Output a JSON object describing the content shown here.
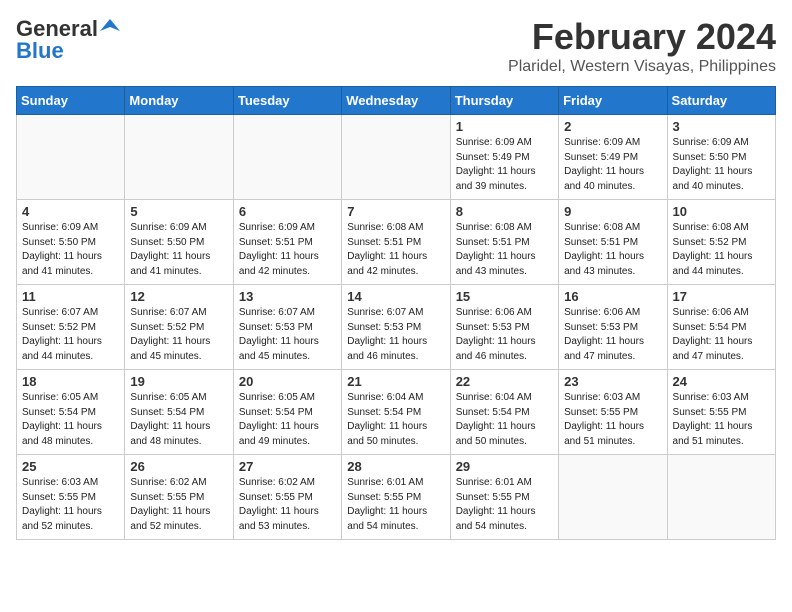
{
  "header": {
    "logo_general": "General",
    "logo_blue": "Blue",
    "month": "February 2024",
    "location": "Plaridel, Western Visayas, Philippines"
  },
  "days_of_week": [
    "Sunday",
    "Monday",
    "Tuesday",
    "Wednesday",
    "Thursday",
    "Friday",
    "Saturday"
  ],
  "weeks": [
    [
      {
        "day": "",
        "empty": true
      },
      {
        "day": "",
        "empty": true
      },
      {
        "day": "",
        "empty": true
      },
      {
        "day": "",
        "empty": true
      },
      {
        "day": "1",
        "sunrise": "6:09 AM",
        "sunset": "5:49 PM",
        "daylight": "11 hours and 39 minutes."
      },
      {
        "day": "2",
        "sunrise": "6:09 AM",
        "sunset": "5:49 PM",
        "daylight": "11 hours and 40 minutes."
      },
      {
        "day": "3",
        "sunrise": "6:09 AM",
        "sunset": "5:50 PM",
        "daylight": "11 hours and 40 minutes."
      }
    ],
    [
      {
        "day": "4",
        "sunrise": "6:09 AM",
        "sunset": "5:50 PM",
        "daylight": "11 hours and 41 minutes."
      },
      {
        "day": "5",
        "sunrise": "6:09 AM",
        "sunset": "5:50 PM",
        "daylight": "11 hours and 41 minutes."
      },
      {
        "day": "6",
        "sunrise": "6:09 AM",
        "sunset": "5:51 PM",
        "daylight": "11 hours and 42 minutes."
      },
      {
        "day": "7",
        "sunrise": "6:08 AM",
        "sunset": "5:51 PM",
        "daylight": "11 hours and 42 minutes."
      },
      {
        "day": "8",
        "sunrise": "6:08 AM",
        "sunset": "5:51 PM",
        "daylight": "11 hours and 43 minutes."
      },
      {
        "day": "9",
        "sunrise": "6:08 AM",
        "sunset": "5:51 PM",
        "daylight": "11 hours and 43 minutes."
      },
      {
        "day": "10",
        "sunrise": "6:08 AM",
        "sunset": "5:52 PM",
        "daylight": "11 hours and 44 minutes."
      }
    ],
    [
      {
        "day": "11",
        "sunrise": "6:07 AM",
        "sunset": "5:52 PM",
        "daylight": "11 hours and 44 minutes."
      },
      {
        "day": "12",
        "sunrise": "6:07 AM",
        "sunset": "5:52 PM",
        "daylight": "11 hours and 45 minutes."
      },
      {
        "day": "13",
        "sunrise": "6:07 AM",
        "sunset": "5:53 PM",
        "daylight": "11 hours and 45 minutes."
      },
      {
        "day": "14",
        "sunrise": "6:07 AM",
        "sunset": "5:53 PM",
        "daylight": "11 hours and 46 minutes."
      },
      {
        "day": "15",
        "sunrise": "6:06 AM",
        "sunset": "5:53 PM",
        "daylight": "11 hours and 46 minutes."
      },
      {
        "day": "16",
        "sunrise": "6:06 AM",
        "sunset": "5:53 PM",
        "daylight": "11 hours and 47 minutes."
      },
      {
        "day": "17",
        "sunrise": "6:06 AM",
        "sunset": "5:54 PM",
        "daylight": "11 hours and 47 minutes."
      }
    ],
    [
      {
        "day": "18",
        "sunrise": "6:05 AM",
        "sunset": "5:54 PM",
        "daylight": "11 hours and 48 minutes."
      },
      {
        "day": "19",
        "sunrise": "6:05 AM",
        "sunset": "5:54 PM",
        "daylight": "11 hours and 48 minutes."
      },
      {
        "day": "20",
        "sunrise": "6:05 AM",
        "sunset": "5:54 PM",
        "daylight": "11 hours and 49 minutes."
      },
      {
        "day": "21",
        "sunrise": "6:04 AM",
        "sunset": "5:54 PM",
        "daylight": "11 hours and 50 minutes."
      },
      {
        "day": "22",
        "sunrise": "6:04 AM",
        "sunset": "5:54 PM",
        "daylight": "11 hours and 50 minutes."
      },
      {
        "day": "23",
        "sunrise": "6:03 AM",
        "sunset": "5:55 PM",
        "daylight": "11 hours and 51 minutes."
      },
      {
        "day": "24",
        "sunrise": "6:03 AM",
        "sunset": "5:55 PM",
        "daylight": "11 hours and 51 minutes."
      }
    ],
    [
      {
        "day": "25",
        "sunrise": "6:03 AM",
        "sunset": "5:55 PM",
        "daylight": "11 hours and 52 minutes."
      },
      {
        "day": "26",
        "sunrise": "6:02 AM",
        "sunset": "5:55 PM",
        "daylight": "11 hours and 52 minutes."
      },
      {
        "day": "27",
        "sunrise": "6:02 AM",
        "sunset": "5:55 PM",
        "daylight": "11 hours and 53 minutes."
      },
      {
        "day": "28",
        "sunrise": "6:01 AM",
        "sunset": "5:55 PM",
        "daylight": "11 hours and 54 minutes."
      },
      {
        "day": "29",
        "sunrise": "6:01 AM",
        "sunset": "5:55 PM",
        "daylight": "11 hours and 54 minutes."
      },
      {
        "day": "",
        "empty": true
      },
      {
        "day": "",
        "empty": true
      }
    ]
  ]
}
